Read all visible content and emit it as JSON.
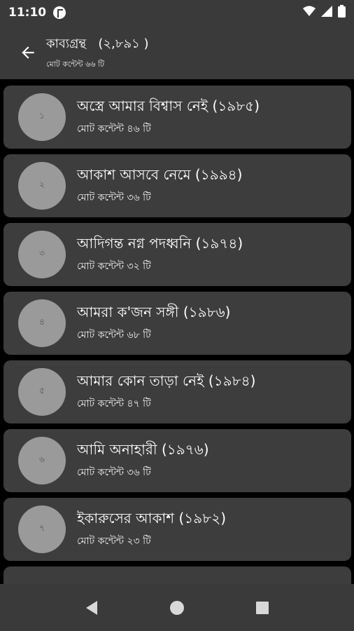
{
  "status": {
    "time": "11:10"
  },
  "header": {
    "title": "কাব্যগ্রন্থ   (২,৮৯১ )",
    "subtitle": "মোট কন্টেন্ট ৬৬ টি"
  },
  "books": [
    {
      "number": "১",
      "title": "অস্ত্রে আমার বিশ্বাস নেই (১৯৮৫)",
      "count": "মোট কন্টেন্ট ৪৬ টি"
    },
    {
      "number": "২",
      "title": "আকাশ আসবে নেমে (১৯৯৪)",
      "count": "মোট কন্টেন্ট ৩৬ টি"
    },
    {
      "number": "৩",
      "title": "আদিগন্ত নগ্ন পদধ্বনি (১৯৭৪)",
      "count": "মোট কন্টেন্ট ৩২ টি"
    },
    {
      "number": "৪",
      "title": "আমরা ক'জন সঙ্গী (১৯৮৬)",
      "count": "মোট কন্টেন্ট ৬৮ টি"
    },
    {
      "number": "৫",
      "title": "আমার কোন তাড়া নেই (১৯৮৪)",
      "count": "মোট কন্টেন্ট ৪৭ টি"
    },
    {
      "number": "৬",
      "title": "আমি অনাহারী (১৯৭৬)",
      "count": "মোট কন্টেন্ট ৩৬ টি"
    },
    {
      "number": "৭",
      "title": "ইকারুসের আকাশ (১৯৮২)",
      "count": "মোট কন্টেন্ট ২৩ টি"
    }
  ]
}
